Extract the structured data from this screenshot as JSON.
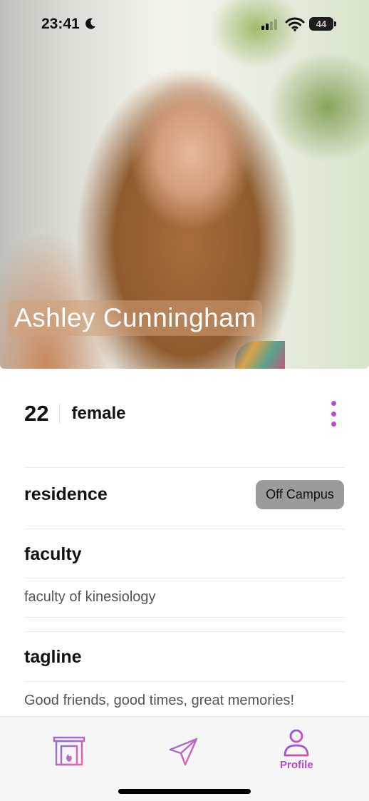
{
  "status_bar": {
    "time": "23:41",
    "battery": "44"
  },
  "profile": {
    "name": "Ashley Cunningham",
    "age": "22",
    "gender": "female"
  },
  "sections": {
    "residence": {
      "title": "residence",
      "badge": "Off Campus"
    },
    "faculty": {
      "title": "faculty",
      "value": "faculty of kinesiology"
    },
    "tagline": {
      "title": "tagline",
      "value": "Good friends, good times, great memories!"
    }
  },
  "tabs": [
    {
      "icon": "fireplace-icon",
      "label": ""
    },
    {
      "icon": "send-icon",
      "label": ""
    },
    {
      "icon": "person-icon",
      "label": "Profile"
    }
  ],
  "colors": {
    "accent": "#b54fc9",
    "badge": "#9b9b9b"
  }
}
